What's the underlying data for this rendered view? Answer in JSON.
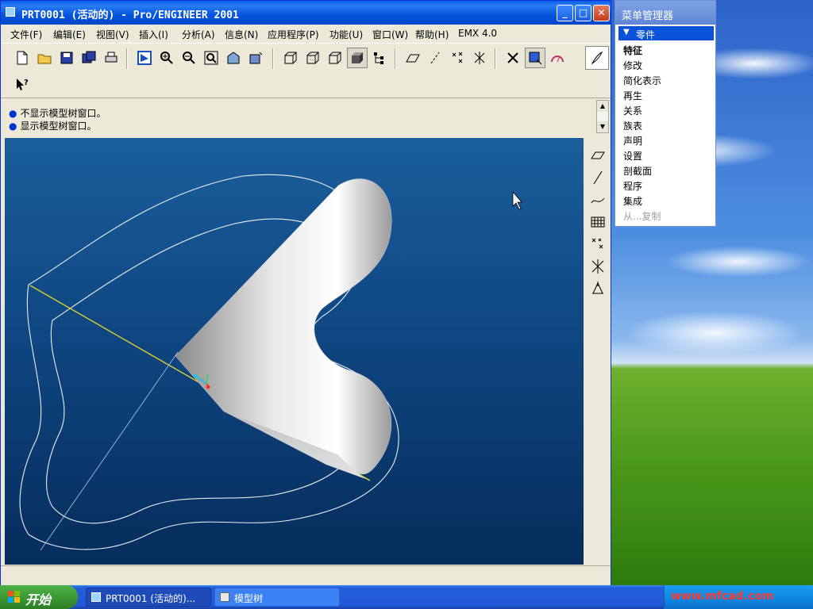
{
  "window": {
    "title": "PRT0001 (活动的) - Pro/ENGINEER 2001",
    "minimize": "_",
    "maximize": "□",
    "close": "✕"
  },
  "menubar": [
    "文件(F)",
    "编辑(E)",
    "视图(V)",
    "插入(I)",
    "分析(A)",
    "信息(N)",
    "应用程序(P)",
    "功能(U)",
    "窗口(W)",
    "帮助(H)",
    "EMX 4.0"
  ],
  "messages": [
    "不显示模型树窗口。",
    "显示模型树窗口。"
  ],
  "menu_manager": {
    "title": "菜单管理器",
    "header": "零件",
    "items": [
      {
        "label": "特征",
        "state": "bold"
      },
      {
        "label": "修改",
        "state": "normal"
      },
      {
        "label": "简化表示",
        "state": "normal"
      },
      {
        "label": "再生",
        "state": "normal"
      },
      {
        "label": "关系",
        "state": "normal"
      },
      {
        "label": "族表",
        "state": "normal"
      },
      {
        "label": "声明",
        "state": "normal"
      },
      {
        "label": "设置",
        "state": "normal"
      },
      {
        "label": "剖截面",
        "state": "normal"
      },
      {
        "label": "程序",
        "state": "normal"
      },
      {
        "label": "集成",
        "state": "normal"
      },
      {
        "label": "从...复制",
        "state": "disabled"
      }
    ]
  },
  "taskbar": {
    "start": "开始",
    "tasks": [
      "PRT0001 (活动的)...",
      "模型树"
    ],
    "tray_watermark": "www.mfcad.com"
  },
  "colors": {
    "titlebar": "#0555de",
    "viewport_top": "#1a5e9c",
    "viewport_bottom": "#062d5c",
    "menu_header": "#0a52d8"
  }
}
